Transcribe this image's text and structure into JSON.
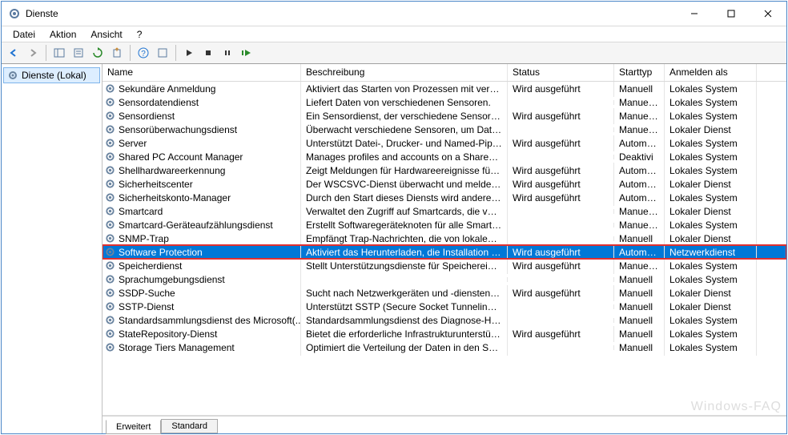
{
  "window": {
    "title": "Dienste"
  },
  "menubar": [
    "Datei",
    "Aktion",
    "Ansicht",
    "?"
  ],
  "tree": {
    "root": "Dienste (Lokal)"
  },
  "columns": {
    "name": "Name",
    "desc": "Beschreibung",
    "status": "Status",
    "start": "Starttyp",
    "logon": "Anmelden als"
  },
  "services": [
    {
      "name": "Sekundäre Anmeldung",
      "desc": "Aktiviert das Starten von Prozessen mit versc...",
      "status": "Wird ausgeführt",
      "start": "Manuell",
      "logon": "Lokales System"
    },
    {
      "name": "Sensordatendienst",
      "desc": "Liefert Daten von verschiedenen Sensoren.",
      "status": "",
      "start": "Manuell ...",
      "logon": "Lokales System"
    },
    {
      "name": "Sensordienst",
      "desc": "Ein Sensordienst, der verschiedene Sensorfun...",
      "status": "Wird ausgeführt",
      "start": "Manuell ...",
      "logon": "Lokales System"
    },
    {
      "name": "Sensorüberwachungsdienst",
      "desc": "Überwacht verschiedene Sensoren, um Daten...",
      "status": "",
      "start": "Manuell ...",
      "logon": "Lokaler Dienst"
    },
    {
      "name": "Server",
      "desc": "Unterstützt Datei-, Drucker- und Named-Pipe...",
      "status": "Wird ausgeführt",
      "start": "Automa...",
      "logon": "Lokales System"
    },
    {
      "name": "Shared PC Account Manager",
      "desc": "Manages profiles and accounts on a SharedP...",
      "status": "",
      "start": "Deaktivi",
      "logon": "Lokales System"
    },
    {
      "name": "Shellhardwareerkennung",
      "desc": "Zeigt Meldungen für Hardwareereignisse für ...",
      "status": "Wird ausgeführt",
      "start": "Automa...",
      "logon": "Lokales System"
    },
    {
      "name": "Sicherheitscenter",
      "desc": "Der WSCSVC-Dienst überwacht und meldet Si...",
      "status": "Wird ausgeführt",
      "start": "Automa...",
      "logon": "Lokaler Dienst"
    },
    {
      "name": "Sicherheitskonto-Manager",
      "desc": "Durch den Start dieses Diensts wird anderen ...",
      "status": "Wird ausgeführt",
      "start": "Automa...",
      "logon": "Lokales System"
    },
    {
      "name": "Smartcard",
      "desc": "Verwaltet den Zugriff auf Smartcards, die von ...",
      "status": "",
      "start": "Manuell ...",
      "logon": "Lokaler Dienst"
    },
    {
      "name": "Smartcard-Geräteaufzählungsdienst",
      "desc": "Erstellt Softwaregeräteknoten für alle Smartca...",
      "status": "",
      "start": "Manuell ...",
      "logon": "Lokales System"
    },
    {
      "name": "SNMP-Trap",
      "desc": "Empfängt Trap-Nachrichten, die von lokalen ...",
      "status": "",
      "start": "Manuell",
      "logon": "Lokaler Dienst"
    },
    {
      "name": "Software Protection",
      "desc": "Aktiviert das Herunterladen, die Installation u...",
      "status": "Wird ausgeführt",
      "start": "Automa...",
      "logon": "Netzwerkdienst",
      "selected": true,
      "highlighted": true
    },
    {
      "name": "Speicherdienst",
      "desc": "Stellt Unterstützungsdienste für Speichereinst...",
      "status": "Wird ausgeführt",
      "start": "Manuell ...",
      "logon": "Lokales System"
    },
    {
      "name": "Sprachumgebungsdienst",
      "desc": "",
      "status": "",
      "start": "Manuell",
      "logon": "Lokales System"
    },
    {
      "name": "SSDP-Suche",
      "desc": "Sucht nach Netzwerkgeräten und -diensten, ...",
      "status": "Wird ausgeführt",
      "start": "Manuell",
      "logon": "Lokaler Dienst"
    },
    {
      "name": "SSTP-Dienst",
      "desc": "Unterstützt SSTP (Secure Socket Tunneling-Pr...",
      "status": "",
      "start": "Manuell",
      "logon": "Lokaler Dienst"
    },
    {
      "name": "Standardsammlungsdienst des Microsoft(...",
      "desc": "Standardsammlungsdienst des Diagnose-Hu...",
      "status": "",
      "start": "Manuell",
      "logon": "Lokales System"
    },
    {
      "name": "StateRepository-Dienst",
      "desc": "Bietet die erforderliche Infrastrukturunterstütz...",
      "status": "Wird ausgeführt",
      "start": "Manuell",
      "logon": "Lokales System"
    },
    {
      "name": "Storage Tiers Management",
      "desc": "Optimiert die Verteilung der Daten in den Spe...",
      "status": "",
      "start": "Manuell",
      "logon": "Lokales System"
    }
  ],
  "tabs": {
    "active": "Erweitert",
    "inactive": "Standard"
  },
  "watermark": "Windows-FAQ"
}
